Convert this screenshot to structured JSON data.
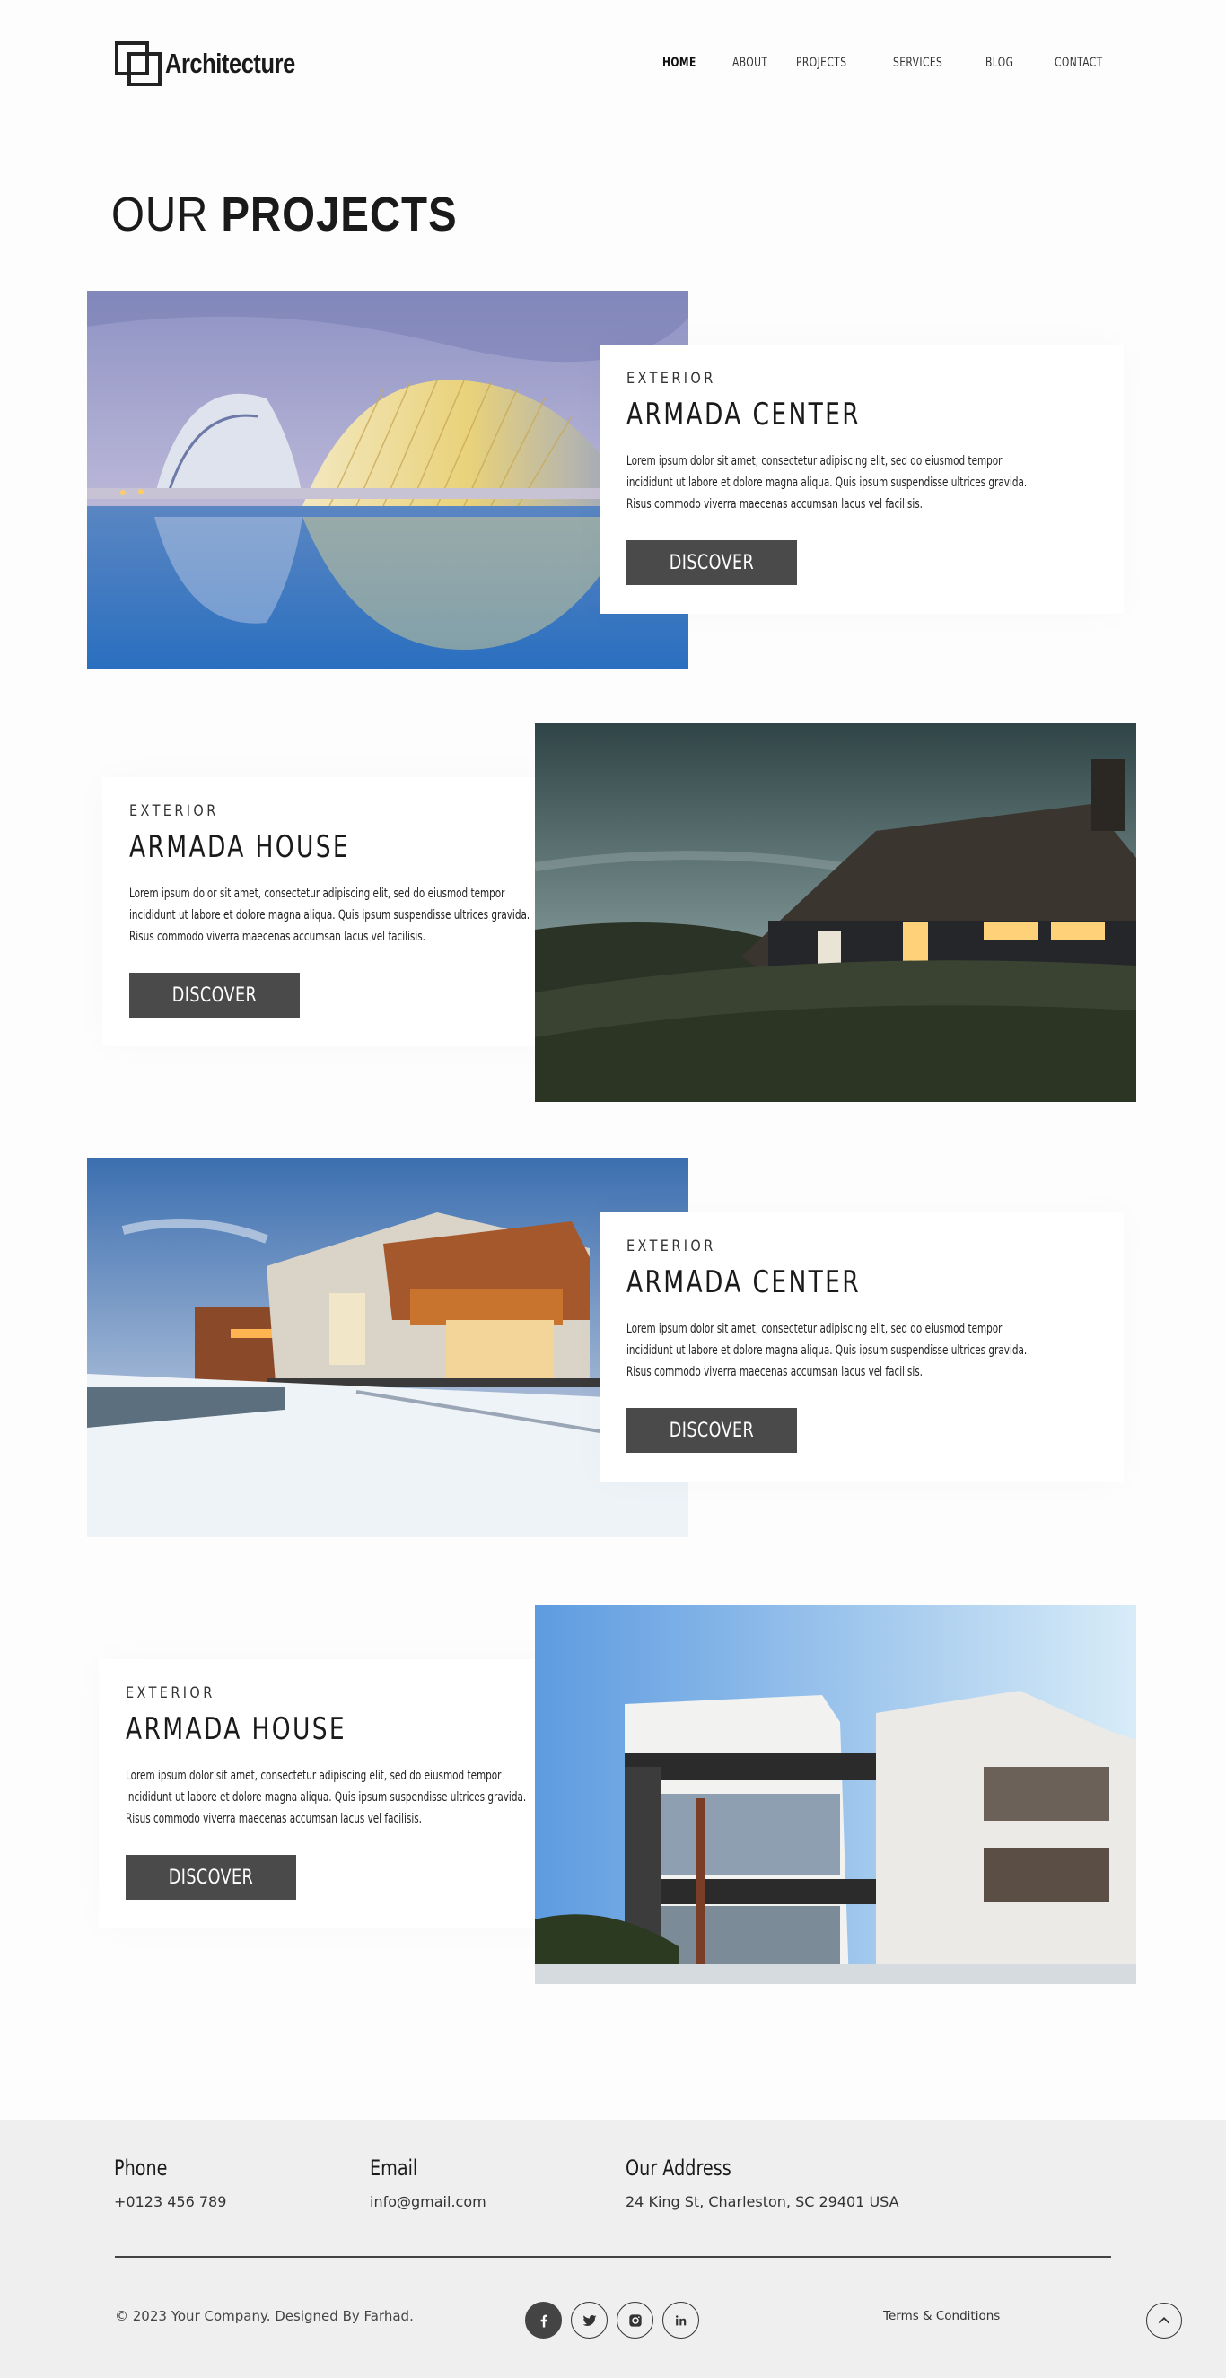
{
  "header": {
    "logo_text": "Architecture",
    "nav": [
      {
        "label": "HOME",
        "active": true
      },
      {
        "label": "ABOUT",
        "active": false
      },
      {
        "label": "PROJECTS",
        "active": false
      },
      {
        "label": "SERVICES",
        "active": false
      },
      {
        "label": "BLOG",
        "active": false
      },
      {
        "label": "CONTACT",
        "active": false
      }
    ]
  },
  "title": {
    "light": "OUR",
    "bold": "PROJECTS"
  },
  "projects": [
    {
      "category": "EXTERIOR",
      "title": "ARMADA CENTER",
      "description": "Lorem ipsum dolor sit amet, consectetur adipiscing elit, sed do eiusmod tempor incididunt ut labore et dolore magna aliqua. Quis ipsum suspendisse ultrices gravida. Risus commodo viverra maecenas accumsan lacus vel facilisis.",
      "button": "DISCOVER",
      "image": "futuristic-arts-center"
    },
    {
      "category": "EXTERIOR",
      "title": "ARMADA HOUSE",
      "description": "Lorem ipsum dolor sit amet, consectetur adipiscing elit, sed do eiusmod tempor incididunt ut labore et dolore magna aliqua. Quis ipsum suspendisse ultrices gravida. Risus commodo viverra maecenas accumsan lacus vel facilisis.",
      "button": "DISCOVER",
      "image": "thatched-cottage-dusk"
    },
    {
      "category": "EXTERIOR",
      "title": "ARMADA CENTER",
      "description": "Lorem ipsum dolor sit amet, consectetur adipiscing elit, sed do eiusmod tempor incididunt ut labore et dolore magna aliqua. Quis ipsum suspendisse ultrices gravida. Risus commodo viverra maecenas accumsan lacus vel facilisis.",
      "button": "DISCOVER",
      "image": "modern-house-snow"
    },
    {
      "category": "EXTERIOR",
      "title": "ARMADA HOUSE",
      "description": "Lorem ipsum dolor sit amet, consectetur adipiscing elit, sed do eiusmod tempor incididunt ut labore et dolore magna aliqua. Quis ipsum suspendisse ultrices gravida. Risus commodo viverra maecenas accumsan lacus vel facilisis.",
      "button": "DISCOVER",
      "image": "modern-apartments"
    }
  ],
  "footer": {
    "phone_label": "Phone",
    "phone_value": "+0123 456 789",
    "email_label": "Email",
    "email_value": "info@gmail.com",
    "address_label": "Our Address",
    "address_value": "24  King St, Charleston, SC 29401 USA",
    "copyright": "© 2023 Your Company. Designed By Farhad.",
    "socials": [
      "facebook-icon",
      "twitter-icon",
      "instagram-icon",
      "linkedin-icon"
    ],
    "terms": "Terms & Conditions"
  },
  "colors": {
    "button_bg": "#4a4a4a",
    "footer_bg": "#efefef",
    "text": "#1a1a1a"
  }
}
